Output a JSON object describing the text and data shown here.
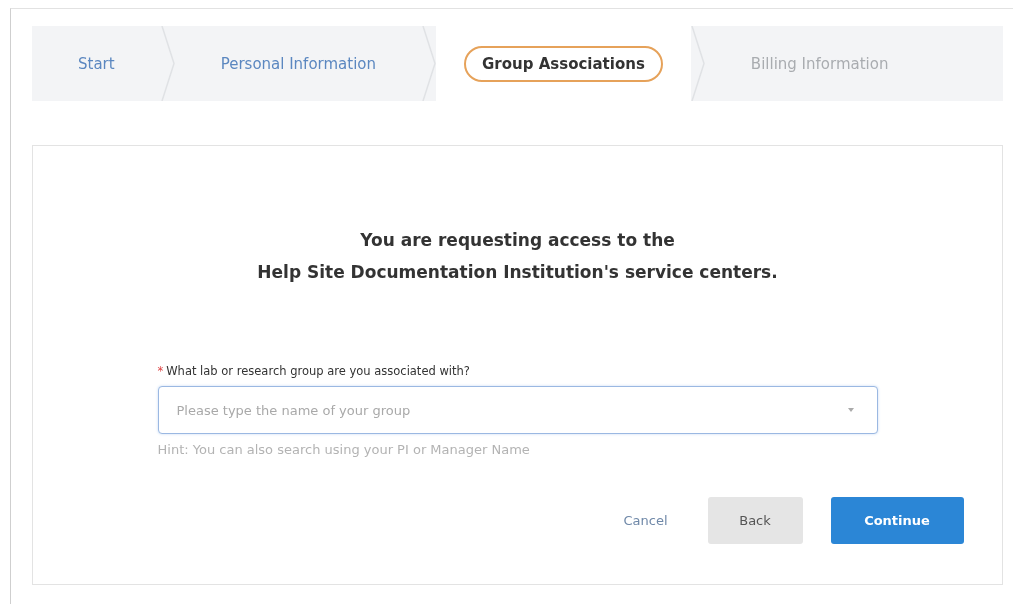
{
  "steps": [
    {
      "label": "Start",
      "completed": true,
      "selected": false
    },
    {
      "label": "Personal Information",
      "completed": true,
      "selected": false
    },
    {
      "label": "Group Associations",
      "completed": false,
      "selected": true
    },
    {
      "label": "Billing Information",
      "completed": false,
      "selected": false
    }
  ],
  "heading": {
    "line_1": "You are requesting access to the",
    "line_2": "Help Site Documentation Institution's service centers."
  },
  "group_field": {
    "required_mark": "*",
    "label": "What lab or research group are you associated with?",
    "placeholder": "Please type the name of your group",
    "hint": "Hint: You can also search using your PI or Manager Name"
  },
  "buttons": {
    "cancel": "Cancel",
    "back": "Back",
    "continue": "Continue"
  }
}
